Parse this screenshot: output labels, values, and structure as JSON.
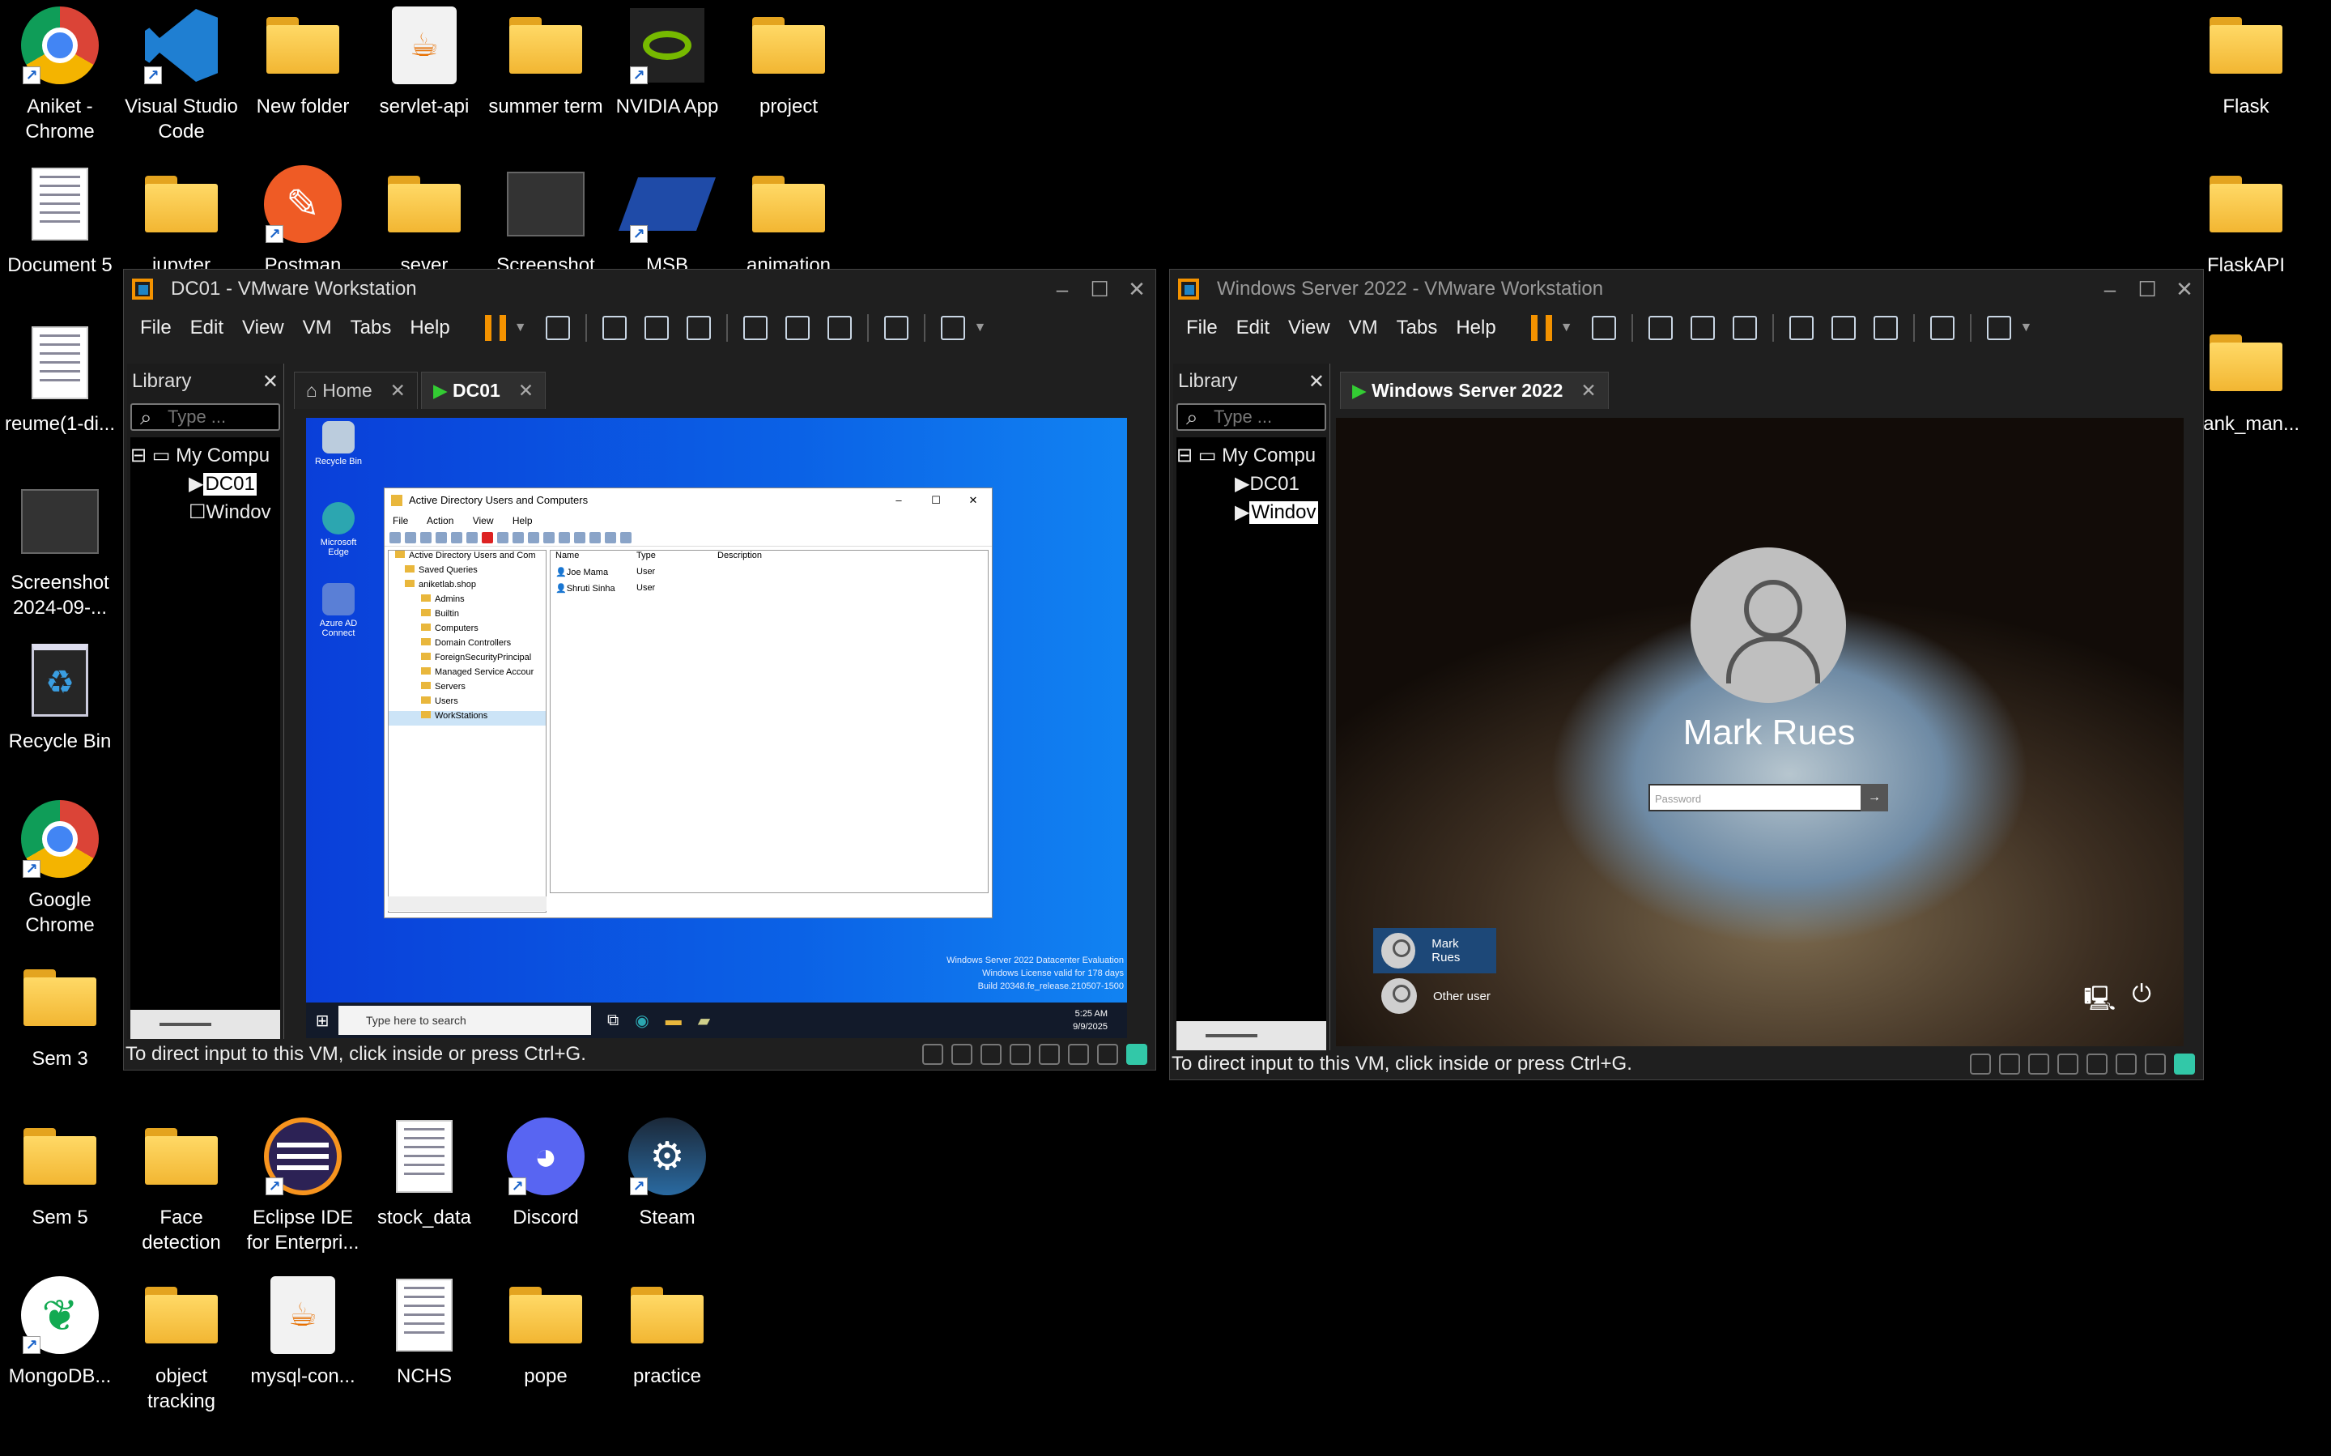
{
  "desktop": {
    "icons": [
      {
        "label": "Aniket -\nChrome",
        "icon": "chrome-icon"
      },
      {
        "label": "Visual Studio\nCode",
        "icon": "vscode-icon"
      },
      {
        "label": "New folder",
        "icon": "folder-icon"
      },
      {
        "label": "servlet-api",
        "icon": "java-icon"
      },
      {
        "label": "summer term",
        "icon": "folder-icon"
      },
      {
        "label": "NVIDIA App",
        "icon": "nvidia-icon"
      },
      {
        "label": "project",
        "icon": "folder-icon"
      },
      {
        "label": "Flask",
        "icon": "folder-icon"
      },
      {
        "label": "Document 5",
        "icon": "document-icon"
      },
      {
        "label": "jupyter",
        "icon": "folder-icon"
      },
      {
        "label": "Postman",
        "icon": "postman-icon"
      },
      {
        "label": "sever",
        "icon": "folder-icon"
      },
      {
        "label": "Screenshot",
        "icon": "screenshot-icon"
      },
      {
        "label": "MSB",
        "icon": "msb-icon"
      },
      {
        "label": "animation",
        "icon": "folder-icon"
      },
      {
        "label": "FlaskAPI",
        "icon": "folder-icon"
      },
      {
        "label": "reume(1-di...",
        "icon": "document-icon"
      },
      {
        "label": "bank_man...",
        "icon": "folder-icon"
      },
      {
        "label": "Screenshot\n2024-09-...",
        "icon": "screenshot-icon"
      },
      {
        "label": "Recycle Bin",
        "icon": "recycle-bin-icon"
      },
      {
        "label": "Google\nChrome",
        "icon": "chrome-icon"
      },
      {
        "label": "Sem 3",
        "icon": "folder-icon"
      },
      {
        "label": "Sem 5",
        "icon": "folder-icon"
      },
      {
        "label": "Face\ndetection",
        "icon": "folder-icon"
      },
      {
        "label": "Eclipse IDE\nfor Enterpri...",
        "icon": "eclipse-icon"
      },
      {
        "label": "stock_data",
        "icon": "document-icon"
      },
      {
        "label": "Discord",
        "icon": "discord-icon"
      },
      {
        "label": "Steam",
        "icon": "steam-icon"
      },
      {
        "label": "MongoDB...",
        "icon": "mongodb-icon"
      },
      {
        "label": "object\ntracking",
        "icon": "folder-icon"
      },
      {
        "label": "mysql-con...",
        "icon": "java-icon"
      },
      {
        "label": "NCHS",
        "icon": "document-icon"
      },
      {
        "label": "pope",
        "icon": "folder-icon"
      },
      {
        "label": "practice",
        "icon": "folder-icon"
      }
    ]
  },
  "vm1": {
    "title": "DC01 - VMware Workstation",
    "menu": [
      "File",
      "Edit",
      "View",
      "VM",
      "Tabs",
      "Help"
    ],
    "library": {
      "title": "Library",
      "search_placeholder": "Type ...",
      "tree": [
        "My Compu",
        "DC01",
        "Windov"
      ]
    },
    "tabs": [
      {
        "label": "Home"
      },
      {
        "label": "DC01"
      }
    ],
    "status": "To direct input to this VM, click inside or press Ctrl+G.",
    "guest": {
      "desktop_icons": [
        "Recycle Bin",
        "Microsoft\nEdge",
        "Azure AD\nConnect"
      ],
      "aduc": {
        "title": "Active Directory Users and Computers",
        "menu": [
          "File",
          "Action",
          "View",
          "Help"
        ],
        "tree": [
          "Active Directory Users and Com",
          "Saved Queries",
          "aniketlab.shop",
          "Admins",
          "Builtin",
          "Computers",
          "Domain Controllers",
          "ForeignSecurityPrincipal",
          "Managed Service Accour",
          "Servers",
          "Users",
          "WorkStations"
        ],
        "columns": [
          "Name",
          "Type",
          "Description"
        ],
        "rows": [
          {
            "name": "Joe Mama",
            "type": "User"
          },
          {
            "name": "Shruti Sinha",
            "type": "User"
          }
        ]
      },
      "watermark": [
        "Windows Server 2022 Datacenter Evaluation",
        "Windows License valid for 178 days",
        "Build 20348.fe_release.210507-1500"
      ],
      "taskbar": {
        "search": "Type here to search",
        "time": "5:25 AM",
        "date": "9/9/2025"
      }
    }
  },
  "vm2": {
    "title": "Windows Server 2022 - VMware Workstation",
    "menu": [
      "File",
      "Edit",
      "View",
      "VM",
      "Tabs",
      "Help"
    ],
    "library": {
      "title": "Library",
      "search_placeholder": "Type ...",
      "tree": [
        "My Compu",
        "DC01",
        "Windov"
      ]
    },
    "tabs": [
      {
        "label": "Windows Server 2022"
      }
    ],
    "status": "To direct input to this VM, click inside or press Ctrl+G.",
    "guest": {
      "user_name": "Mark Rues",
      "password_placeholder": "Password",
      "users": [
        "Mark Rues",
        "Other user"
      ]
    }
  }
}
